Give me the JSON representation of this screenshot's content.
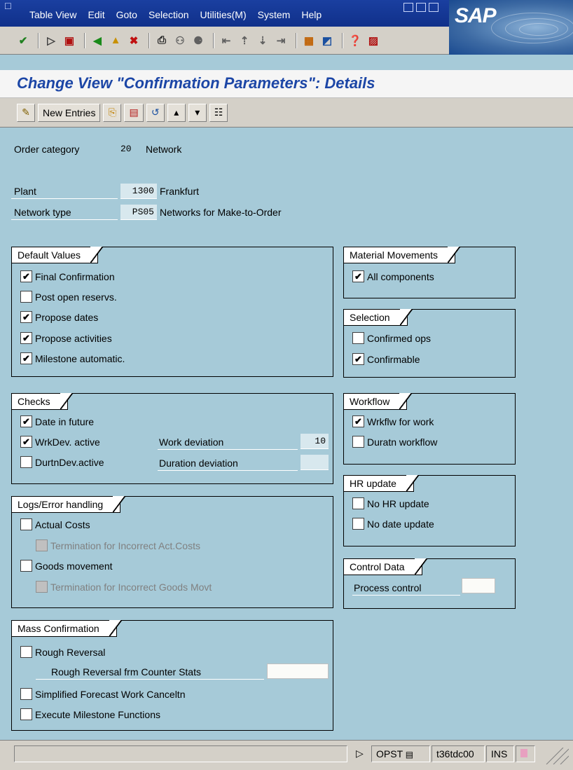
{
  "window": {
    "menu": [
      "Table View",
      "Edit",
      "Goto",
      "Selection",
      "Utilities(M)",
      "System",
      "Help"
    ],
    "logo": "SAP"
  },
  "page": {
    "title": "Change View \"Confirmation Parameters\": Details"
  },
  "app_toolbar": {
    "new_entries": "New Entries"
  },
  "header": {
    "order_category_label": "Order category",
    "order_category_value": "20",
    "order_category_text": "Network",
    "plant_label": "Plant",
    "plant_value": "1300",
    "plant_text": "Frankfurt",
    "network_type_label": "Network type",
    "network_type_value": "PS05",
    "network_type_text": "Networks for Make-to-Order"
  },
  "default_values": {
    "title": "Default Values",
    "items": [
      {
        "label": "Final Confirmation",
        "checked": true
      },
      {
        "label": "Post open reservs.",
        "checked": false
      },
      {
        "label": "Propose dates",
        "checked": true
      },
      {
        "label": "Propose activities",
        "checked": true
      },
      {
        "label": "Milestone automatic.",
        "checked": true
      }
    ]
  },
  "checks": {
    "title": "Checks",
    "date_in_future": "Date in future",
    "wrkdev_active": "WrkDev. active",
    "durtndev_active": "DurtnDev.active",
    "work_deviation_label": "Work deviation",
    "work_deviation_value": "10",
    "duration_deviation_label": "Duration deviation",
    "duration_deviation_value": ""
  },
  "logs": {
    "title": "Logs/Error handling",
    "actual_costs": "Actual Costs",
    "term_costs": "Termination for Incorrect Act.Costs",
    "goods_movement": "Goods movement",
    "term_goods": "Termination for Incorrect Goods Movt"
  },
  "mass": {
    "title": "Mass Confirmation",
    "rough_reversal": "Rough Reversal",
    "rough_reversal_counter": "Rough Reversal frm Counter Stats",
    "rough_reversal_counter_value": "",
    "simplified_forecast": "Simplified Forecast Work Canceltn",
    "execute_milestone": "Execute Milestone Functions"
  },
  "material_movements": {
    "title": "Material Movements",
    "all_components": "All components"
  },
  "selection": {
    "title": "Selection",
    "confirmed_ops": "Confirmed ops",
    "confirmable": "Confirmable"
  },
  "workflow": {
    "title": "Workflow",
    "wrkflw_for_work": "Wrkflw for work",
    "duratn_workflow": "Duratn workflow"
  },
  "hr_update": {
    "title": "HR update",
    "no_hr_update": "No HR update",
    "no_date_update": "No date update"
  },
  "control_data": {
    "title": "Control Data",
    "process_control_label": "Process control",
    "process_control_value": ""
  },
  "statusbar": {
    "transaction": "OPST",
    "server": "t36tdc00",
    "mode": "INS"
  },
  "colors": {
    "background": "#a6cad8",
    "title_blue": "#1c46a6",
    "menubar": "#10308a"
  }
}
